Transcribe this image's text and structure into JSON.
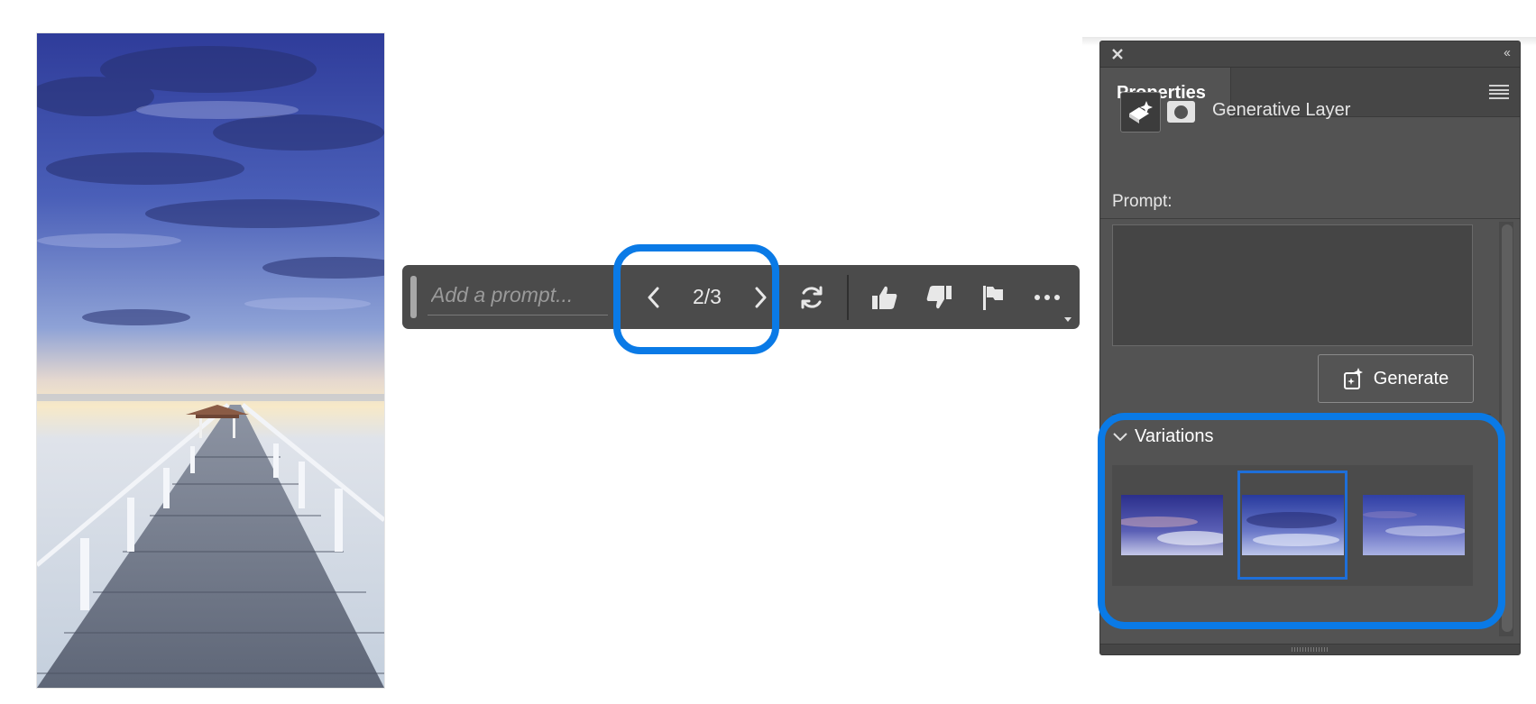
{
  "canvas": {
    "photo_subject": "wooden pier with pavilion under twilight sky"
  },
  "taskbar": {
    "prompt_placeholder": "Add a prompt...",
    "variation_counter": "2/3",
    "icons": [
      "previous-chevron-icon",
      "next-chevron-icon",
      "regenerate-icon",
      "thumbs-up-icon",
      "thumbs-down-icon",
      "flag-icon",
      "more-icon"
    ]
  },
  "panel": {
    "tab_label": "Properties",
    "layer_type": "Generative Layer",
    "prompt_label": "Prompt:",
    "prompt_value": "",
    "generate_label": "Generate",
    "variations_label": "Variations",
    "variations": [
      {
        "selected": false
      },
      {
        "selected": true
      },
      {
        "selected": false
      }
    ]
  },
  "colors": {
    "highlight": "#0a7ae6",
    "panel_bg": "#535353",
    "taskbar_bg": "#4b4b4b",
    "selected_thumb": "#1e6fd9"
  }
}
